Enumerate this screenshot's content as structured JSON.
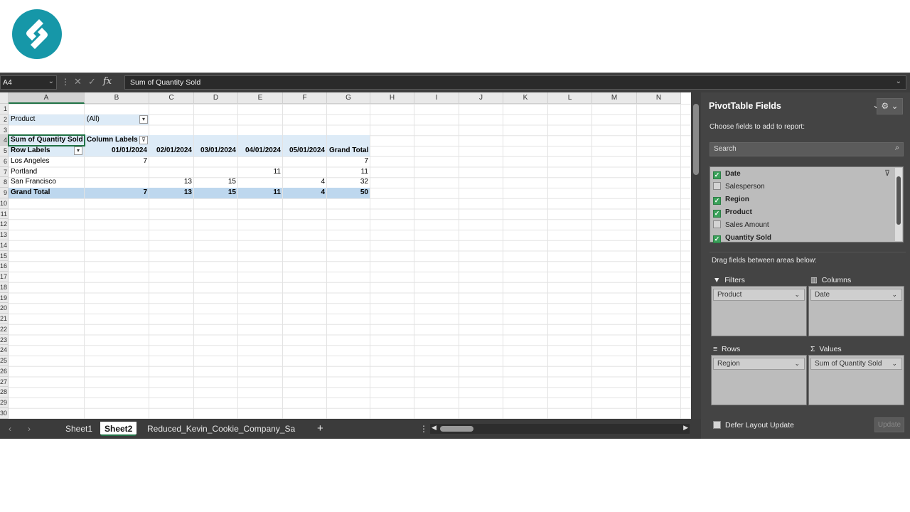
{
  "name_box": "A4",
  "formula": "Sum of Quantity Sold",
  "columns": [
    "A",
    "B",
    "C",
    "D",
    "E",
    "F",
    "G",
    "H",
    "I",
    "J",
    "K",
    "L",
    "M",
    "N"
  ],
  "rows": [
    "1",
    "2",
    "3",
    "4",
    "5",
    "6",
    "7",
    "8",
    "9",
    "10",
    "11",
    "12",
    "13",
    "14",
    "15",
    "16",
    "17",
    "18",
    "19",
    "20",
    "21",
    "22",
    "23",
    "24",
    "25",
    "26",
    "27",
    "28",
    "29",
    "30"
  ],
  "sheet": {
    "filter_label": "Product",
    "filter_value": "(All)",
    "values_header": "Sum of Quantity Sold",
    "column_labels": "Column Labels",
    "row_labels": "Row Labels",
    "dates": [
      "01/01/2024",
      "02/01/2024",
      "03/01/2024",
      "04/01/2024",
      "05/01/2024"
    ],
    "grand_total": "Grand Total",
    "data_rows": [
      {
        "label": "Los Angeles",
        "values": [
          "7",
          "",
          "",
          "",
          "",
          "7"
        ]
      },
      {
        "label": "Portland",
        "values": [
          "",
          "",
          "",
          "11",
          "",
          "11"
        ]
      },
      {
        "label": "San Francisco",
        "values": [
          "",
          "13",
          "15",
          "",
          "4",
          "32"
        ]
      }
    ],
    "total_row": {
      "label": "Grand Total",
      "values": [
        "7",
        "13",
        "15",
        "11",
        "4",
        "50"
      ]
    }
  },
  "tabs": [
    "Sheet1",
    "Sheet2",
    "Reduced_Kevin_Cookie_Company_Sa"
  ],
  "active_tab": "Sheet2",
  "pane": {
    "title": "PivotTable Fields",
    "choose": "Choose fields to add to report:",
    "search_placeholder": "Search",
    "fields": [
      {
        "name": "Date",
        "checked": true
      },
      {
        "name": "Salesperson",
        "checked": false
      },
      {
        "name": "Region",
        "checked": true
      },
      {
        "name": "Product",
        "checked": true
      },
      {
        "name": "Sales Amount",
        "checked": false
      },
      {
        "name": "Quantity Sold",
        "checked": true
      }
    ],
    "drag_label": "Drag fields between areas below:",
    "filters_label": "Filters",
    "columns_label": "Columns",
    "rows_label": "Rows",
    "values_label": "Values",
    "filters_item": "Product",
    "columns_item": "Date",
    "rows_item": "Region",
    "values_item": "Sum of Quantity Sold",
    "defer": "Defer Layout Update",
    "update": "Update"
  }
}
